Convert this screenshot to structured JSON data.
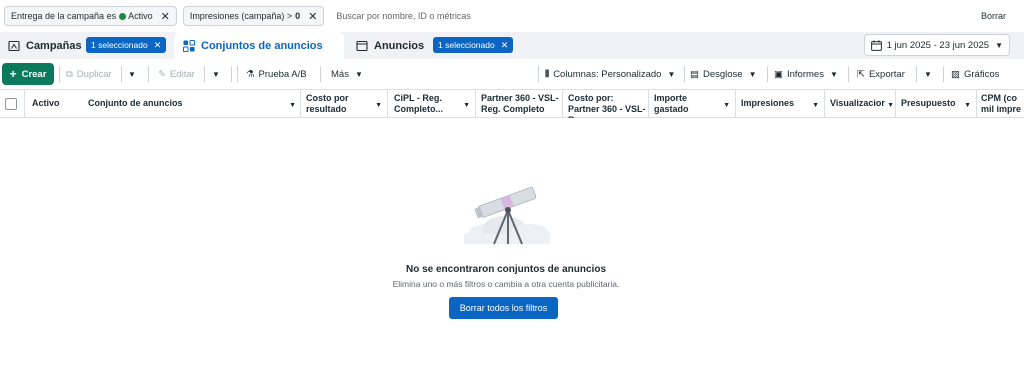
{
  "filters": {
    "chip1_label": "Entrega de la campaña es",
    "chip1_value": "Activo",
    "chip2_label": "Impresiones (campaña) >",
    "chip2_value": "0",
    "search_placeholder": "Buscar por nombre, ID o métricas",
    "clear_label": "Borrar"
  },
  "tabs": {
    "campaigns": "Campañas",
    "campaigns_badge": "1 seleccionado",
    "adsets": "Conjuntos de anuncios",
    "ads": "Anuncios",
    "ads_badge": "1 seleccionado"
  },
  "date_range": "1 jun 2025 - 23 jun 2025",
  "toolbar": {
    "create": "Crear",
    "duplicate": "Duplicar",
    "edit": "Editar",
    "ab_test": "Prueba A/B",
    "more": "Más",
    "columns": "Columnas: Personalizado",
    "breakdown": "Desglose",
    "reports": "Informes",
    "export": "Exportar",
    "charts": "Gráficos"
  },
  "table": {
    "headers": [
      "Activo",
      "Conjunto de anuncios",
      "Costo por resultado",
      "CiPL - Reg. Completo...",
      "Partner 360 - VSL- Reg. Completo",
      "Costo por: Partner 360 - VSL- Reg....",
      "Importe gastado",
      "Impresiones",
      "Visualizacior",
      "Presupuesto",
      "CPM (co mil impre"
    ]
  },
  "empty_state": {
    "title": "No se encontraron conjuntos de anuncios",
    "subtitle": "Elimina uno o más filtros o cambia a otra cuenta publicitaria.",
    "button": "Borrar todos los filtros"
  },
  "colors": {
    "primary": "#0a66c2",
    "create": "#0b7a5c",
    "active_dot": "#1a8a3f"
  }
}
